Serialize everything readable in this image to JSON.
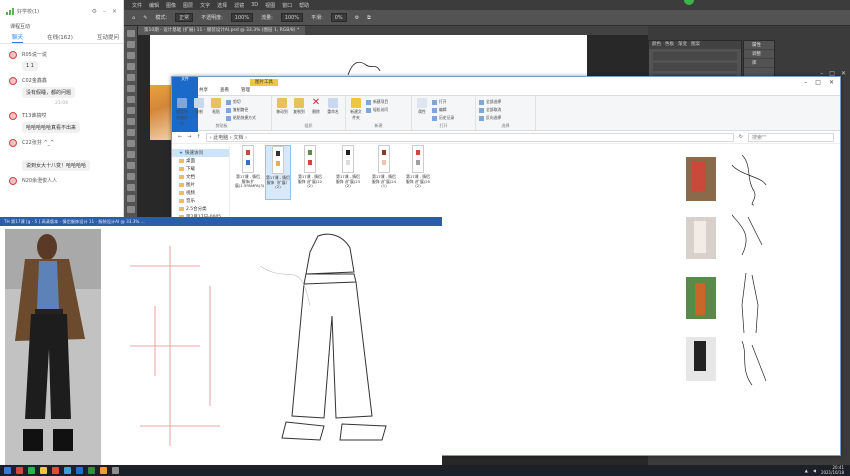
{
  "photoshop": {
    "menu": [
      "文件",
      "编辑",
      "图像",
      "图层",
      "文字",
      "选择",
      "滤镜",
      "3D",
      "视图",
      "窗口",
      "帮助"
    ],
    "options": {
      "mode_label": "模式:",
      "mode_value": "正常",
      "opacity_label": "不透明度:",
      "opacity_value": "100%",
      "flow_label": "流量:",
      "flow_value": "100%",
      "smooth_label": "平滑:",
      "smooth_value": "0%"
    },
    "doc_tab": "第10期 - 设计基础 (扩展) 11 - 服装设计AI.psd @ 33.3% (图层 1, RGB/8) *",
    "panel_tabs": [
      "颜色",
      "色板",
      "渐变",
      "图案"
    ],
    "mini_panel": [
      "属性",
      "调整",
      "库"
    ]
  },
  "chat": {
    "title": "好学校(1)",
    "section": "课程互动",
    "tabs": [
      "聊天",
      "在线(162)",
      "互动提问"
    ],
    "messages": [
      {
        "name": "R05说一说",
        "text": "1 1"
      },
      {
        "name": "C02金鑫鑫",
        "text": "没有假睡，都的问题"
      },
      {
        "time": "21:04"
      },
      {
        "name": "T13谁搞哎",
        "text": "哈哈哈哈哈真看不出来"
      },
      {
        "name": "C22张芬",
        "text": "^_^"
      },
      {
        "name": "",
        "text": "说到女大十八变！哈哈哈哈"
      },
      {
        "name": "N20余澄俊人人",
        "text": ""
      }
    ]
  },
  "explorer": {
    "tool_badge": "图片工具",
    "ribbon_tabs": [
      "文件",
      "主页",
      "共享",
      "查看",
      "管理"
    ],
    "groups": {
      "clipboard": {
        "label": "剪贴板",
        "pin": "固定到快速访问",
        "copy": "复制",
        "paste": "粘贴",
        "cut": "剪切",
        "copy_path": "复制路径",
        "paste_shortcut": "粘贴快捷方式"
      },
      "organize": {
        "label": "组织",
        "move": "移动到",
        "copyto": "复制到",
        "delete": "删除",
        "rename": "重命名"
      },
      "new": {
        "label": "新建",
        "folder": "新建文件夹",
        "item": "新建项目",
        "easy": "轻松访问"
      },
      "open": {
        "label": "打开",
        "props": "属性",
        "open": "打开",
        "edit": "编辑",
        "history": "历史记录"
      },
      "select": {
        "label": "选择",
        "all": "全部选择",
        "none": "全部取消",
        "invert": "反向选择"
      }
    },
    "address": "› 此电脑 › 文档 ›",
    "search_placeholder": "搜索\"\"",
    "nav": [
      "快速访问",
      "桌面",
      "下载",
      "文档",
      "图片",
      "视频",
      "音乐",
      "2.5合分类",
      "第2月17日-0005...",
      "此电脑"
    ],
    "files": [
      {
        "name": "第17课 - 情侣服饰(扩展)1.5PAMPA(3)",
        "colors": [
          "#c94a3a",
          "#3a6fc9"
        ],
        "sel": false
      },
      {
        "name": "第17课 - 情侣服饰（扩展）(2)",
        "colors": [
          "#333",
          "#e8b24a"
        ],
        "sel": true
      },
      {
        "name": "第17课 - 情侣服饰 (扩展)22 (2)",
        "colors": [
          "#5a8f4a",
          "#c94a3a"
        ],
        "sel": false
      },
      {
        "name": "第17课 - 情侣服饰 (扩展)23 (2)",
        "colors": [
          "#222",
          "#ddd"
        ],
        "sel": false
      },
      {
        "name": "第17课 - 情侣服饰 (扩展)24 (1)",
        "colors": [
          "#8a3a2a",
          "#f2c4b0"
        ],
        "sel": false
      },
      {
        "name": "第17课 - 情侣服饰 (扩展)25 (2)",
        "colors": [
          "#c94a3a",
          "#a0a0a0"
        ],
        "sel": false
      }
    ]
  },
  "video": {
    "title_bar": "TH 第17课 [g - 5 ] 高清版本 - 情侣服饰设计 11 - 服装设计AI @ 33.3% ..."
  },
  "taskbar": {
    "time": "20:41",
    "date": "2021/10/18"
  }
}
